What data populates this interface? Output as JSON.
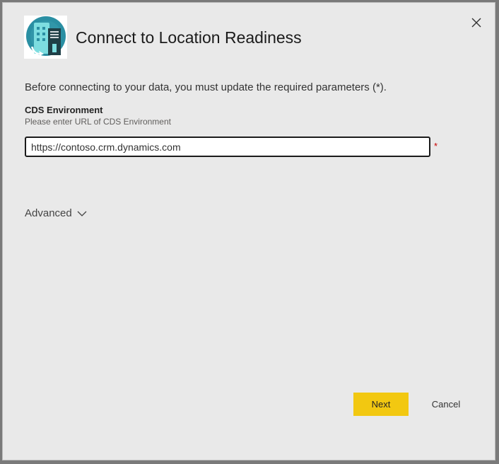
{
  "dialog": {
    "title": "Connect to Location Readiness",
    "logo_icon": "building-icon",
    "close_icon": "close-icon"
  },
  "form": {
    "intro": "Before connecting to your data, you must update the required parameters (*).",
    "parameter": {
      "label": "CDS Environment",
      "help": "Please enter URL of CDS Environment",
      "value": "https://contoso.crm.dynamics.com",
      "required_marker": "*"
    },
    "advanced": {
      "label": "Advanced",
      "icon": "chevron-down-icon"
    }
  },
  "footer": {
    "next_label": "Next",
    "cancel_label": "Cancel"
  },
  "colors": {
    "accent": "#f2c811",
    "required": "#c80000",
    "logo_circle": "#2a8fa3",
    "logo_teal": "#6fd4d9",
    "logo_dark": "#1f3f47"
  }
}
